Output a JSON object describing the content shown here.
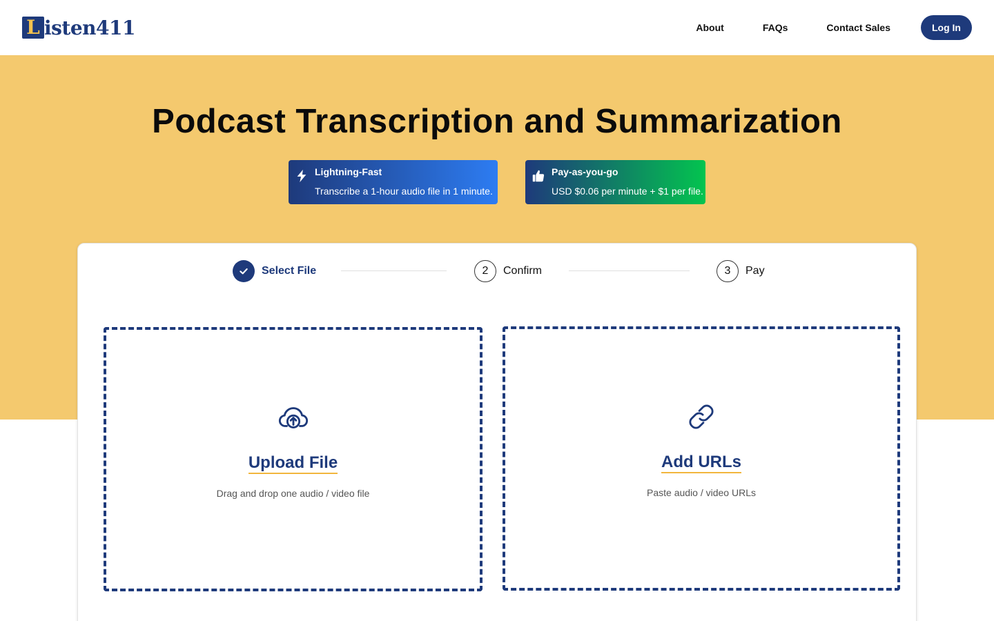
{
  "header": {
    "logo_mark": "L",
    "logo_text": "isten411",
    "nav": [
      "About",
      "FAQs",
      "Contact Sales"
    ],
    "login_label": "Log In"
  },
  "hero": {
    "title": "Podcast Transcription and Summarization",
    "features": [
      {
        "icon": "lightning-icon",
        "title": "Lightning-Fast",
        "desc": "Transcribe a 1-hour audio file in 1 minute."
      },
      {
        "icon": "thumbs-up-icon",
        "title": "Pay-as-you-go",
        "desc": "USD $0.06 per minute + $1 per file."
      }
    ]
  },
  "stepper": {
    "steps": [
      {
        "number": "",
        "label": "Select File",
        "state": "done"
      },
      {
        "number": "2",
        "label": "Confirm",
        "state": "todo"
      },
      {
        "number": "3",
        "label": "Pay",
        "state": "todo"
      }
    ]
  },
  "options": {
    "upload": {
      "icon": "cloud-upload-icon",
      "title": "Upload File",
      "subtitle": "Drag and drop one audio / video file"
    },
    "urls": {
      "icon": "link-icon",
      "title": "Add URLs",
      "subtitle": "Paste audio / video URLs"
    }
  },
  "colors": {
    "brand": "#1e3a7b",
    "hero_bg": "#f4c96e",
    "accent_underline": "#f2b63d"
  }
}
